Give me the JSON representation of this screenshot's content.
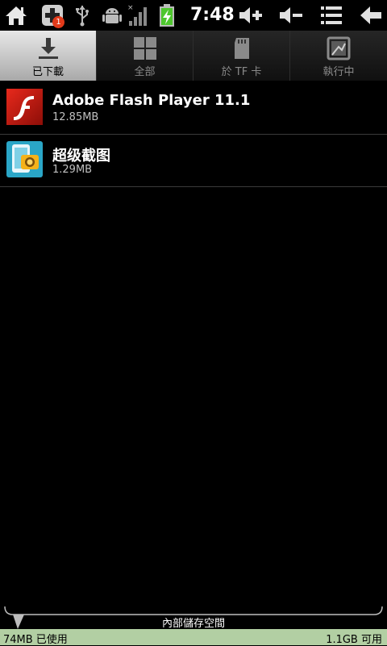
{
  "status_bar": {
    "time": "7:48",
    "notification_count": "1",
    "icons": [
      "home-icon",
      "add-notification-icon",
      "usb-icon",
      "android-debug-icon",
      "signal-icon",
      "battery-charging-icon",
      "volume-up-icon",
      "volume-down-icon",
      "menu-icon",
      "back-icon"
    ],
    "battery_color": "#4ec62e"
  },
  "tabs": [
    {
      "label": "已下載",
      "icon": "download-icon",
      "active": true
    },
    {
      "label": "全部",
      "icon": "grid-icon",
      "active": false
    },
    {
      "label": "於 TF 卡",
      "icon": "sd-card-icon",
      "active": false
    },
    {
      "label": "執行中",
      "icon": "running-apps-icon",
      "active": false
    }
  ],
  "apps": [
    {
      "name": "Adobe Flash Player 11.1",
      "size": "12.85MB",
      "icon": "flash-player-icon",
      "icon_color": "#c8170e"
    },
    {
      "name": "超级截图",
      "size": "1.29MB",
      "icon": "screenshot-app-icon",
      "icon_color": "#2aa6c7"
    }
  ],
  "storage": {
    "label": "內部儲存空間",
    "used": "74MB 已使用",
    "free": "1.1GB 可用",
    "bar_color": "#b2cfa3"
  }
}
